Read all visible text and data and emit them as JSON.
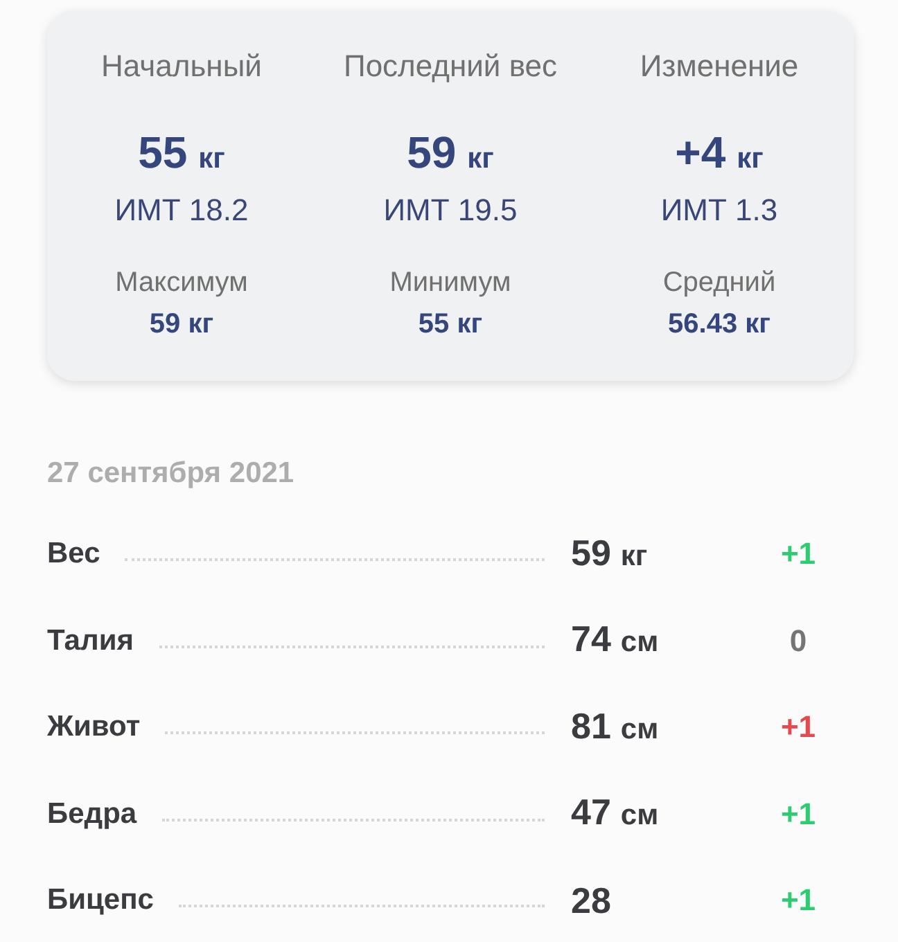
{
  "summary": {
    "columns": [
      {
        "label": "Начальный",
        "value": "55",
        "unit": "кг",
        "bmi": "ИМТ 18.2"
      },
      {
        "label": "Последний вес",
        "value": "59",
        "unit": "кг",
        "bmi": "ИМТ 19.5"
      },
      {
        "label": "Изменение",
        "value": "+4",
        "unit": "кг",
        "bmi": "ИМТ 1.3"
      }
    ],
    "stats": [
      {
        "label": "Максимум",
        "value": "59 кг"
      },
      {
        "label": "Минимум",
        "value": "55 кг"
      },
      {
        "label": "Средний",
        "value": "56.43 кг"
      }
    ]
  },
  "entry": {
    "date": "27 сентября 2021",
    "rows": [
      {
        "name": "Вес",
        "value": "59",
        "unit": "кг",
        "change": "+1",
        "color": "#2ecc71"
      },
      {
        "name": "Талия",
        "value": "74",
        "unit": "см",
        "change": "0",
        "color": "#757575"
      },
      {
        "name": "Живот",
        "value": "81",
        "unit": "см",
        "change": "+1",
        "color": "#e5484d"
      },
      {
        "name": "Бедра",
        "value": "47",
        "unit": "см",
        "change": "+1",
        "color": "#2ecc71"
      },
      {
        "name": "Бицепс",
        "value": "28",
        "change": "+1",
        "color": "#2ecc71"
      }
    ]
  }
}
